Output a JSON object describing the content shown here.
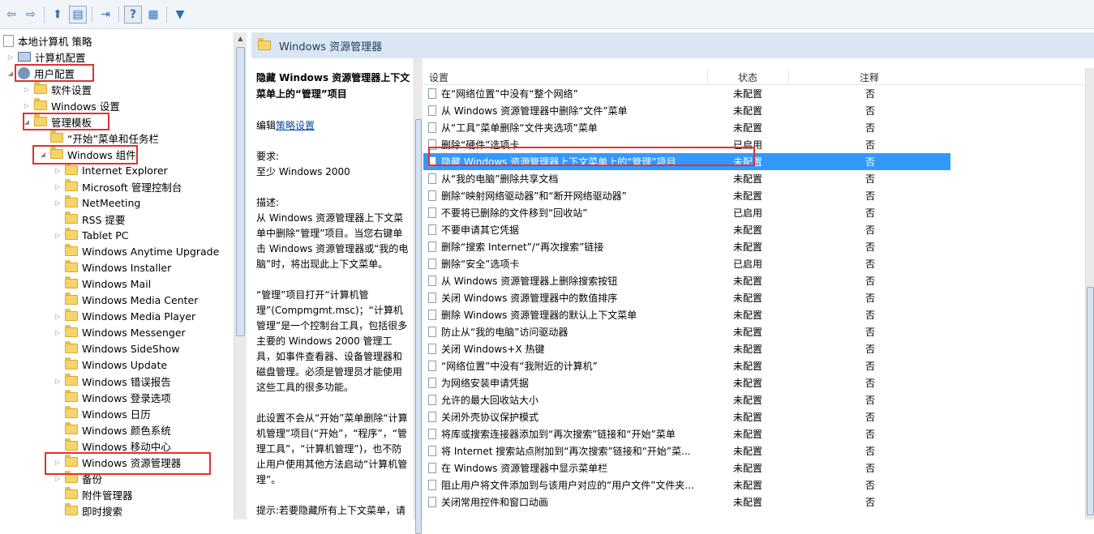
{
  "toolbar": {
    "icons": [
      "back-icon",
      "forward-icon",
      "up-folder-icon",
      "show-tree-icon",
      "export-list-icon",
      "help-icon",
      "extended-view-icon",
      "filter-icon"
    ]
  },
  "tree": {
    "root": "本地计算机 策略",
    "computer_config": "计算机配置",
    "user_config": "用户配置",
    "software_settings": "软件设置",
    "windows_settings": "Windows 设置",
    "admin_templates": "管理模板",
    "start_menu": "“开始”菜单和任务栏",
    "windows_components": "Windows 组件",
    "components": [
      "Internet Explorer",
      "Microsoft 管理控制台",
      "NetMeeting",
      "RSS 提要",
      "Tablet PC",
      "Windows Anytime Upgrade",
      "Windows Installer",
      "Windows Mail",
      "Windows Media Center",
      "Windows Media Player",
      "Windows Messenger",
      "Windows SideShow",
      "Windows Update",
      "Windows 错误报告",
      "Windows 登录选项",
      "Windows 日历",
      "Windows 颜色系统",
      "Windows 移动中心",
      "Windows 资源管理器",
      "备份",
      "附件管理器",
      "即时搜索"
    ]
  },
  "pane": {
    "header": "Windows 资源管理器"
  },
  "description": {
    "title": "隐藏 Windows 资源管理器上下文菜单上的“管理”项目",
    "edit_prefix": "编辑",
    "edit_link": "策略设置",
    "req_label": "要求:",
    "req_value": "至少 Windows 2000",
    "desc_label": "描述:",
    "para1": "从 Windows 资源管理器上下文菜单中删除“管理”项目。当您右键单击 Windows 资源管理器或“我的电脑”时，将出现此上下文菜单。",
    "para2": "“管理”项目打开“计算机管理”(Compmgmt.msc)；“计算机管理”是一个控制台工具，包括很多主要的 Windows 2000 管理工具，如事件查看器、设备管理器和磁盘管理。必须是管理员才能使用这些工具的很多功能。",
    "para3": "此设置不会从“开始”菜单删除“计算机管理”项目(“开始”，“程序”，“管理工具”，“计算机管理”)，也不防止用户使用其他方法启动“计算机管理”。",
    "para4": "提示:若要隐藏所有上下文菜单，请"
  },
  "list": {
    "col_setting": "设置",
    "col_state": "状态",
    "col_comment": "注释",
    "rows": [
      {
        "name": "在“网络位置”中没有“整个网络”",
        "state": "未配置",
        "comment": "否"
      },
      {
        "name": "从 Windows 资源管理器中删除“文件”菜单",
        "state": "未配置",
        "comment": "否"
      },
      {
        "name": "从“工具”菜单删除“文件夹选项”菜单",
        "state": "未配置",
        "comment": "否"
      },
      {
        "name": "删除“硬件”选项卡",
        "state": "已启用",
        "comment": "否"
      },
      {
        "name": "隐藏 Windows 资源管理器上下文菜单上的“管理”项目",
        "state": "未配置",
        "comment": "否"
      },
      {
        "name": "从“我的电脑”删除共享文档",
        "state": "未配置",
        "comment": "否"
      },
      {
        "name": "删除“映射网络驱动器”和“断开网络驱动器”",
        "state": "未配置",
        "comment": "否"
      },
      {
        "name": "不要将已删除的文件移到“回收站”",
        "state": "已启用",
        "comment": "否"
      },
      {
        "name": "不要申请其它凭据",
        "state": "未配置",
        "comment": "否"
      },
      {
        "name": "删除“搜索 Internet”/“再次搜索”链接",
        "state": "未配置",
        "comment": "否"
      },
      {
        "name": "删除“安全”选项卡",
        "state": "已启用",
        "comment": "否"
      },
      {
        "name": "从 Windows 资源管理器上删除搜索按钮",
        "state": "未配置",
        "comment": "否"
      },
      {
        "name": "关闭 Windows 资源管理器中的数值排序",
        "state": "未配置",
        "comment": "否"
      },
      {
        "name": "删除 Windows 资源管理器的默认上下文菜单",
        "state": "未配置",
        "comment": "否"
      },
      {
        "name": "防止从“我的电脑”访问驱动器",
        "state": "未配置",
        "comment": "否"
      },
      {
        "name": "关闭 Windows+X 热键",
        "state": "未配置",
        "comment": "否"
      },
      {
        "name": "“网络位置”中没有“我附近的计算机”",
        "state": "未配置",
        "comment": "否"
      },
      {
        "name": "为网络安装申请凭据",
        "state": "未配置",
        "comment": "否"
      },
      {
        "name": "允许的最大回收站大小",
        "state": "未配置",
        "comment": "否"
      },
      {
        "name": "关闭外壳协议保护模式",
        "state": "未配置",
        "comment": "否"
      },
      {
        "name": "将库或搜索连接器添加到“再次搜索”链接和“开始”菜单",
        "state": "未配置",
        "comment": "否"
      },
      {
        "name": "将 Internet 搜索站点附加到“再次搜索”链接和“开始”菜...",
        "state": "未配置",
        "comment": "否"
      },
      {
        "name": "在 Windows 资源管理器中显示菜单栏",
        "state": "未配置",
        "comment": "否"
      },
      {
        "name": "阻止用户将文件添加到与该用户对应的“用户文件”文件夹...",
        "state": "未配置",
        "comment": "否"
      },
      {
        "name": "关闭常用控件和窗口动画",
        "state": "未配置",
        "comment": "否"
      }
    ]
  },
  "colors": {
    "highlight": "#3399ff",
    "annotation_red": "#e23030"
  }
}
